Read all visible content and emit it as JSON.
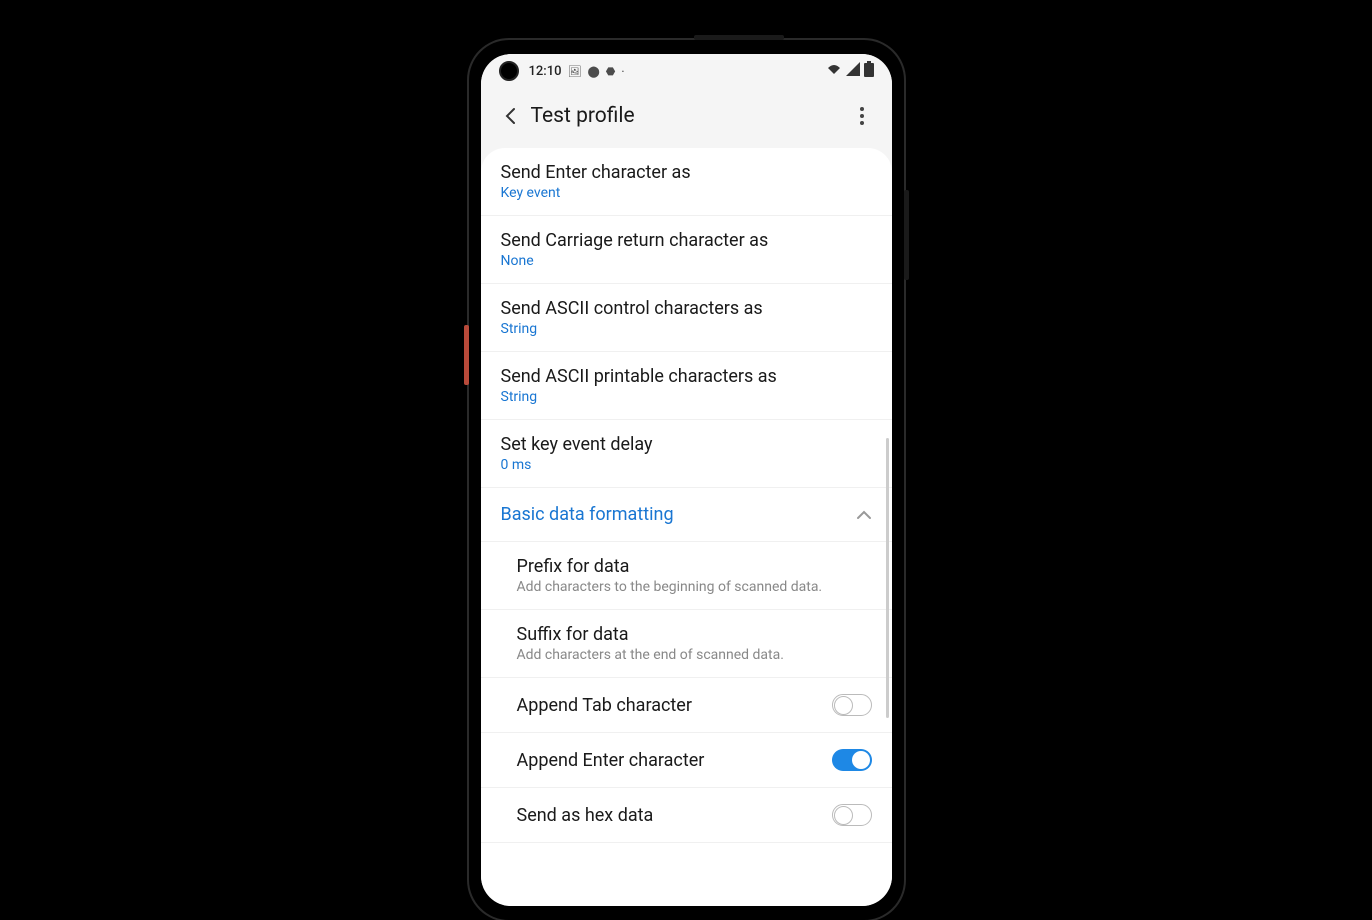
{
  "status_bar": {
    "time": "12:10",
    "icons_left": [
      "image-icon",
      "location-icon",
      "shield-icon"
    ],
    "icons_right": [
      "wifi-icon",
      "signal-icon",
      "battery-icon"
    ]
  },
  "header": {
    "title": "Test profile"
  },
  "settings": [
    {
      "title": "Send Enter character as",
      "value": "Key event"
    },
    {
      "title": "Send Carriage return character as",
      "value": "None"
    },
    {
      "title": "Send ASCII control characters as",
      "value": "String"
    },
    {
      "title": "Send ASCII printable characters as",
      "value": "String"
    },
    {
      "title": "Set key event delay",
      "value": "0 ms"
    }
  ],
  "section": {
    "title": "Basic data formatting",
    "expanded": true
  },
  "sub_settings": [
    {
      "title": "Prefix for data",
      "desc": "Add characters to the beginning of scanned data."
    },
    {
      "title": "Suffix for data",
      "desc": "Add characters at the end of scanned data."
    }
  ],
  "toggles": [
    {
      "label": "Append Tab character",
      "on": false
    },
    {
      "label": "Append Enter character",
      "on": true
    },
    {
      "label": "Send as hex data",
      "on": false
    }
  ]
}
